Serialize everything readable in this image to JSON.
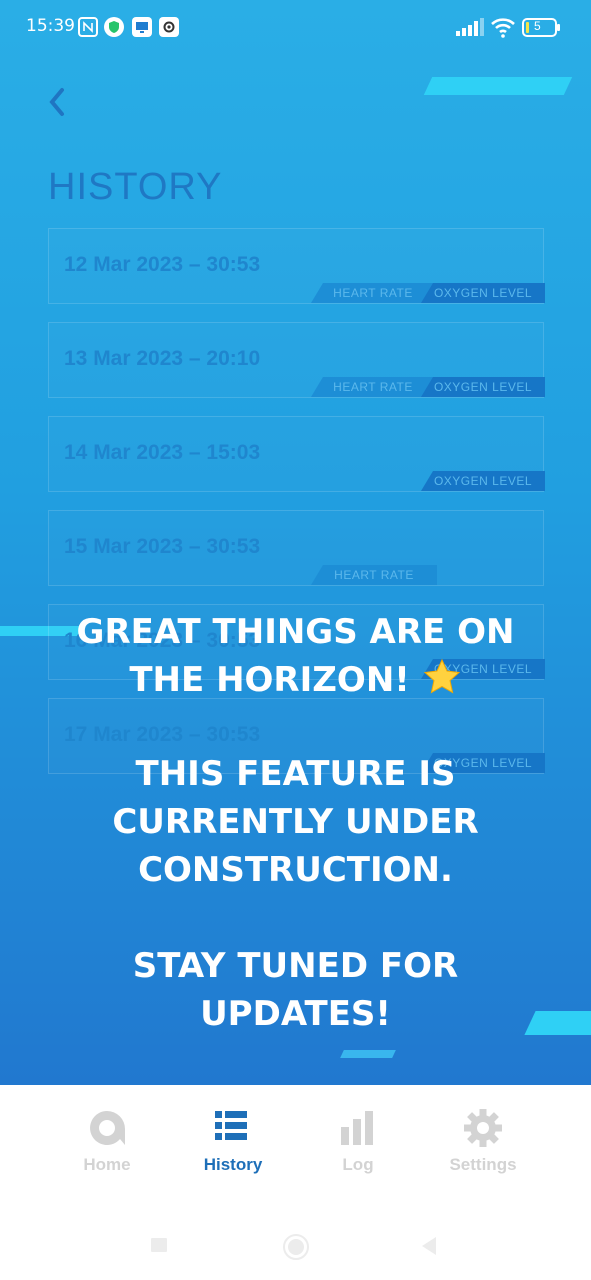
{
  "status_bar": {
    "time": "15:39",
    "battery": "5"
  },
  "screen": {
    "back_icon": "chevron-left-icon",
    "title": "HISTORY",
    "cards": [
      {
        "date": "12 Mar 2023 – 30:53",
        "tags": [
          "HEART RATE",
          "OXYGEN LEVEL"
        ]
      },
      {
        "date": "13 Mar 2023 – 20:10",
        "tags": [
          "HEART RATE",
          "OXYGEN LEVEL"
        ]
      },
      {
        "date": "14 Mar 2023 – 15:03",
        "tags": [
          "OXYGEN LEVEL"
        ]
      },
      {
        "date": "15 Mar 2023 – 30:53",
        "tags": [
          "HEART RATE"
        ]
      },
      {
        "date": "16 Mar 2023 – 30:53",
        "tags": [
          "OXYGEN LEVEL"
        ]
      },
      {
        "date": "17 Mar 2023 – 30:53",
        "tags": [
          "OXYGEN LEVEL"
        ]
      }
    ]
  },
  "overlay": {
    "line1": "GREAT THINGS ARE ON THE HORIZON!",
    "line2": "THIS FEATURE IS CURRENTLY UNDER CONSTRUCTION.",
    "line3": "STAY TUNED FOR UPDATES!",
    "emoji": "star-icon"
  },
  "nav": {
    "items": [
      {
        "label": "Home",
        "icon": "home-logo-icon",
        "active": false
      },
      {
        "label": "History",
        "icon": "list-icon",
        "active": true
      },
      {
        "label": "Log",
        "icon": "bar-chart-icon",
        "active": false
      },
      {
        "label": "Settings",
        "icon": "gear-icon",
        "active": false
      }
    ]
  },
  "colors": {
    "accent": "#1e6fb8",
    "bg_top": "#2aaee6",
    "bg_bottom": "#2178cf",
    "inactive": "#d3d3d3"
  }
}
